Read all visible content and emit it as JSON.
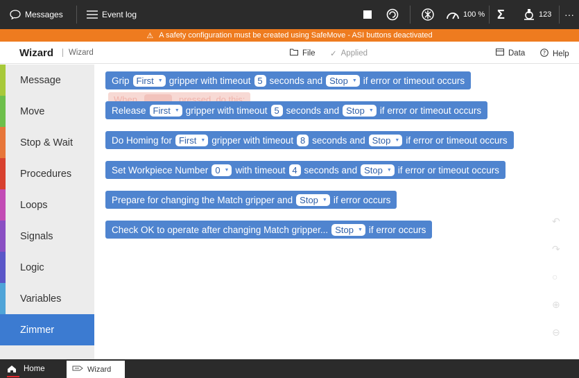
{
  "topbar": {
    "messages_label": "Messages",
    "eventlog_label": "Event log",
    "speed_label": "100 %",
    "robot_count": "123",
    "more_label": "···"
  },
  "warning": {
    "text": "A safety configuration must be created using SafeMove - ASI buttons deactivated"
  },
  "header": {
    "title": "Wizard",
    "subtitle": "Wizard",
    "file_label": "File",
    "applied_label": "Applied",
    "data_label": "Data",
    "help_label": "Help"
  },
  "sidebar": {
    "items": [
      {
        "label": "Message",
        "color": "#a7c93a"
      },
      {
        "label": "Move",
        "color": "#6dbf4b"
      },
      {
        "label": "Stop & Wait",
        "color": "#e7763a"
      },
      {
        "label": "Procedures",
        "color": "#d8412f"
      },
      {
        "label": "Loops",
        "color": "#c24bb5"
      },
      {
        "label": "Signals",
        "color": "#8a4fc3"
      },
      {
        "label": "Logic",
        "color": "#5a56c8"
      },
      {
        "label": "Variables",
        "color": "#4fa4d8"
      },
      {
        "label": "Zimmer",
        "color": "#3c7bd1"
      }
    ],
    "active_index": 8
  },
  "ghost_block": {
    "when_label": "When",
    "pressed_label": "pressed, do this:"
  },
  "blocks": [
    {
      "t1": "Grip",
      "f1": "First",
      "t2": "gripper with timeout",
      "n1": "5",
      "t3": "seconds and",
      "f2": "Stop",
      "t4": "if error or timeout occurs"
    },
    {
      "t1": "Release",
      "f1": "First",
      "t2": "gripper with timeout",
      "n1": "5",
      "t3": "seconds and",
      "f2": "Stop",
      "t4": "if error or timeout occurs"
    },
    {
      "t1": "Do Homing for",
      "f1": "First",
      "t2": "gripper with timeout",
      "n1": "8",
      "t3": "seconds and",
      "f2": "Stop",
      "t4": "if error or timeout occurs"
    },
    {
      "t1": "Set Workpiece Number",
      "f1": "0",
      "t2": "with timeout",
      "n1": "4",
      "t3": "seconds and",
      "f2": "Stop",
      "t4": "if error or timeout occurs"
    },
    {
      "t1": "Prepare for changing the Match gripper and",
      "f1": "Stop",
      "t2": "if error occurs"
    },
    {
      "t1": "Check OK to operate after changing Match gripper...",
      "f1": "Stop",
      "t2": "if error occurs"
    }
  ],
  "bottombar": {
    "home_label": "Home",
    "wizard_tab_label": "Wizard"
  },
  "colors": {
    "block_blue": "#4f84cf",
    "warning_orange": "#ee7b1f",
    "active_blue": "#3c7bd1"
  }
}
